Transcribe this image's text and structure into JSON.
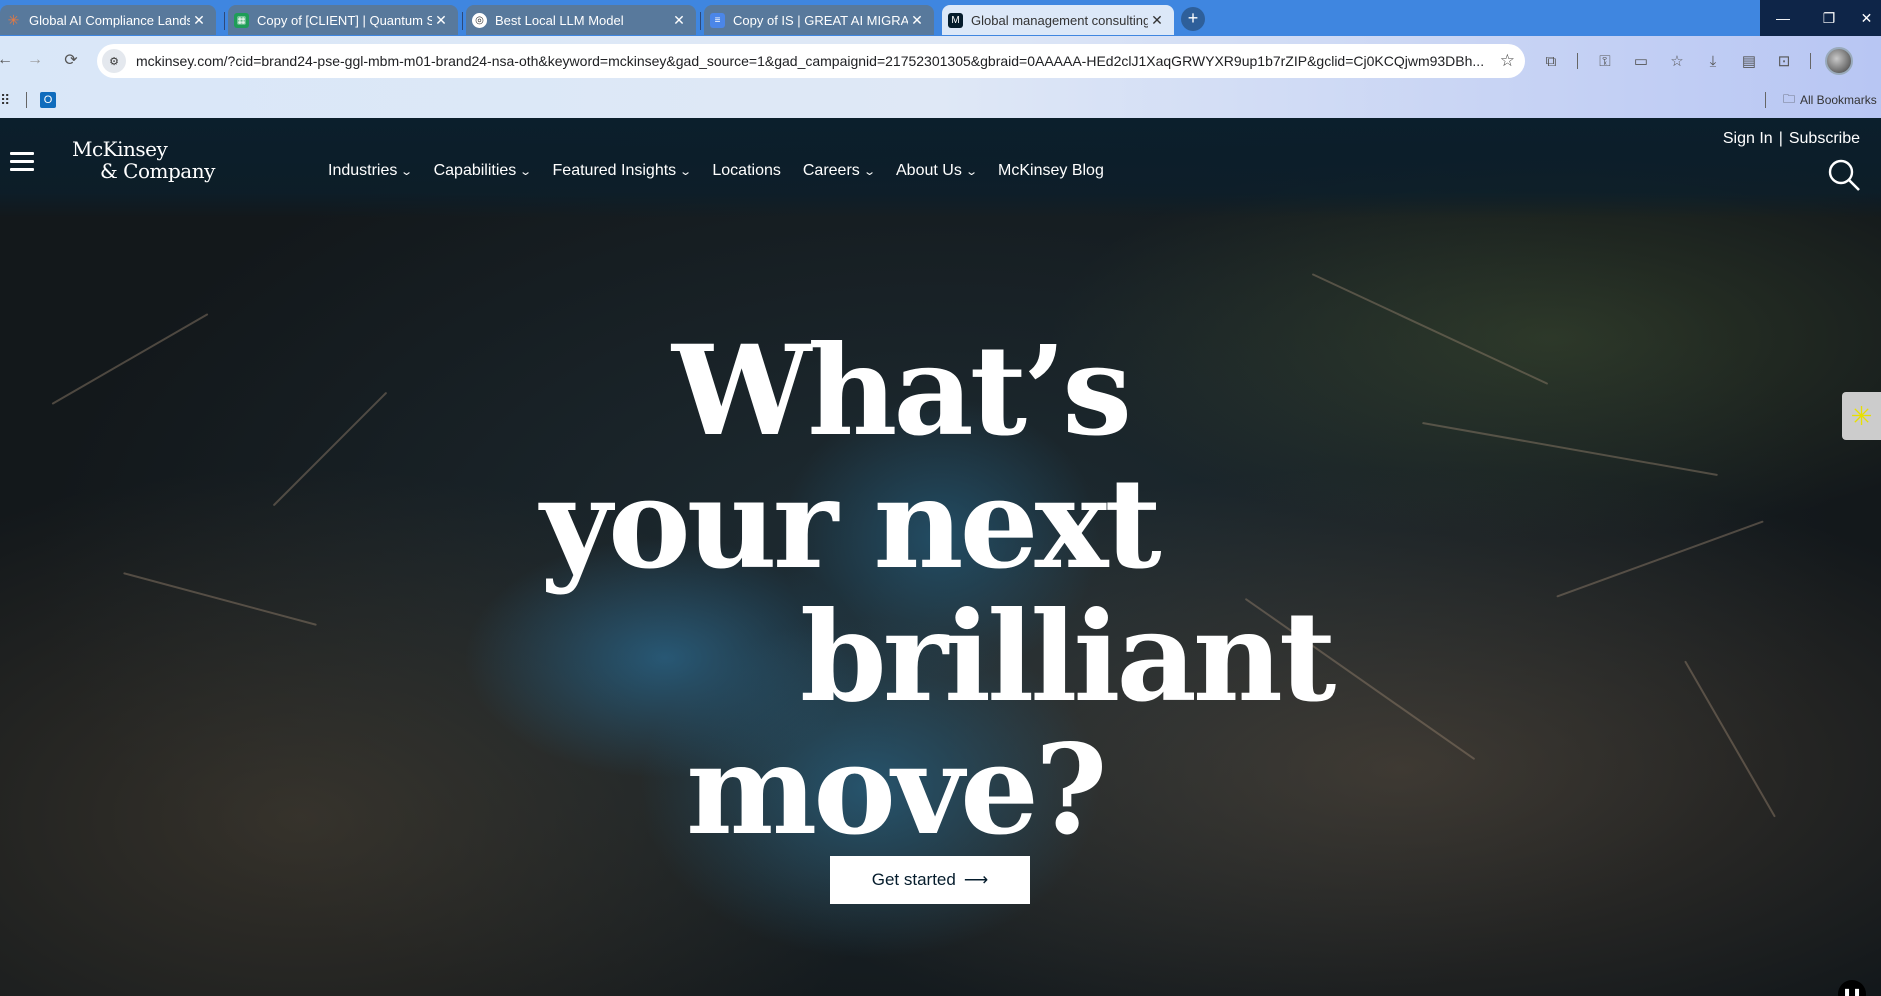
{
  "tabs": [
    {
      "title": "Global AI Compliance Landscap",
      "icon": "claude-icon"
    },
    {
      "title": "Copy of [CLIENT] | Quantum Sa",
      "icon": "sheets-icon"
    },
    {
      "title": "Best Local LLM Model",
      "icon": "chatgpt-icon"
    },
    {
      "title": "Copy of IS | GREAT AI MIGRATIC",
      "icon": "docs-icon"
    },
    {
      "title": "Global management consulting",
      "icon": "mckinsey-icon"
    }
  ],
  "address_bar": {
    "url": "mckinsey.com/?cid=brand24-pse-ggl-mbm-m01-brand24-nsa-oth&keyword=mckinsey&gad_source=1&gad_campaignid=21752301305&gbraid=0AAAAA-HEd2clJ1XaqGRWYXR9up1b7rZIP&gclid=Cj0KCQjwm93DBh..."
  },
  "bookmarks": {
    "all_bookmarks": "All Bookmarks"
  },
  "site": {
    "logo_line1": "McKinsey",
    "logo_line2": "& Company",
    "nav": [
      {
        "label": "Industries",
        "dropdown": true
      },
      {
        "label": "Capabilities",
        "dropdown": true
      },
      {
        "label": "Featured Insights",
        "dropdown": true
      },
      {
        "label": "Locations",
        "dropdown": false
      },
      {
        "label": "Careers",
        "dropdown": true
      },
      {
        "label": "About Us",
        "dropdown": true
      },
      {
        "label": "McKinsey Blog",
        "dropdown": false
      }
    ],
    "sign_in": "Sign In",
    "separator": "|",
    "subscribe": "Subscribe"
  },
  "hero": {
    "line1": "What’s",
    "line2": "your next",
    "line3": "brilliant",
    "line4": "move?",
    "cta_label": "Get started"
  },
  "colors": {
    "tabbar": "#3f86e0",
    "brand_navy": "#051c2c"
  }
}
